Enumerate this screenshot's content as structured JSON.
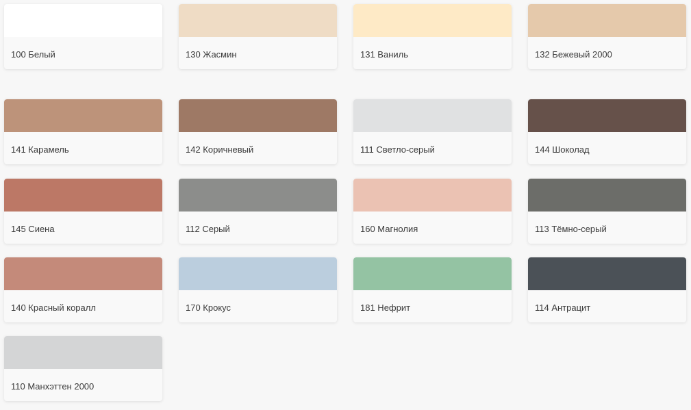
{
  "swatches": [
    {
      "label": "100 Белый",
      "color": "#ffffff"
    },
    {
      "label": "130 Жасмин",
      "color": "#efdcc5"
    },
    {
      "label": "131 Ваниль",
      "color": "#feeac6"
    },
    {
      "label": "132 Бежевый 2000",
      "color": "#e5c9ab"
    },
    {
      "label": "141 Карамель",
      "color": "#bd937a"
    },
    {
      "label": "142 Коричневый",
      "color": "#9e7965"
    },
    {
      "label": "111 Светло-серый",
      "color": "#e0e1e2"
    },
    {
      "label": "144 Шоколад",
      "color": "#66514a"
    },
    {
      "label": "145 Сиена",
      "color": "#bc7866"
    },
    {
      "label": "112 Серый",
      "color": "#8c8d8b"
    },
    {
      "label": "160 Магнолия",
      "color": "#ebc2b3"
    },
    {
      "label": "113 Тёмно-серый",
      "color": "#6c6d69"
    },
    {
      "label": "140 Красный коралл",
      "color": "#c48a7a"
    },
    {
      "label": "170 Крокус",
      "color": "#bbcede"
    },
    {
      "label": "181 Нефрит",
      "color": "#94c3a3"
    },
    {
      "label": "114 Антрацит",
      "color": "#4b5157"
    },
    {
      "label": "110 Манхэттен 2000",
      "color": "#d4d5d6"
    }
  ]
}
